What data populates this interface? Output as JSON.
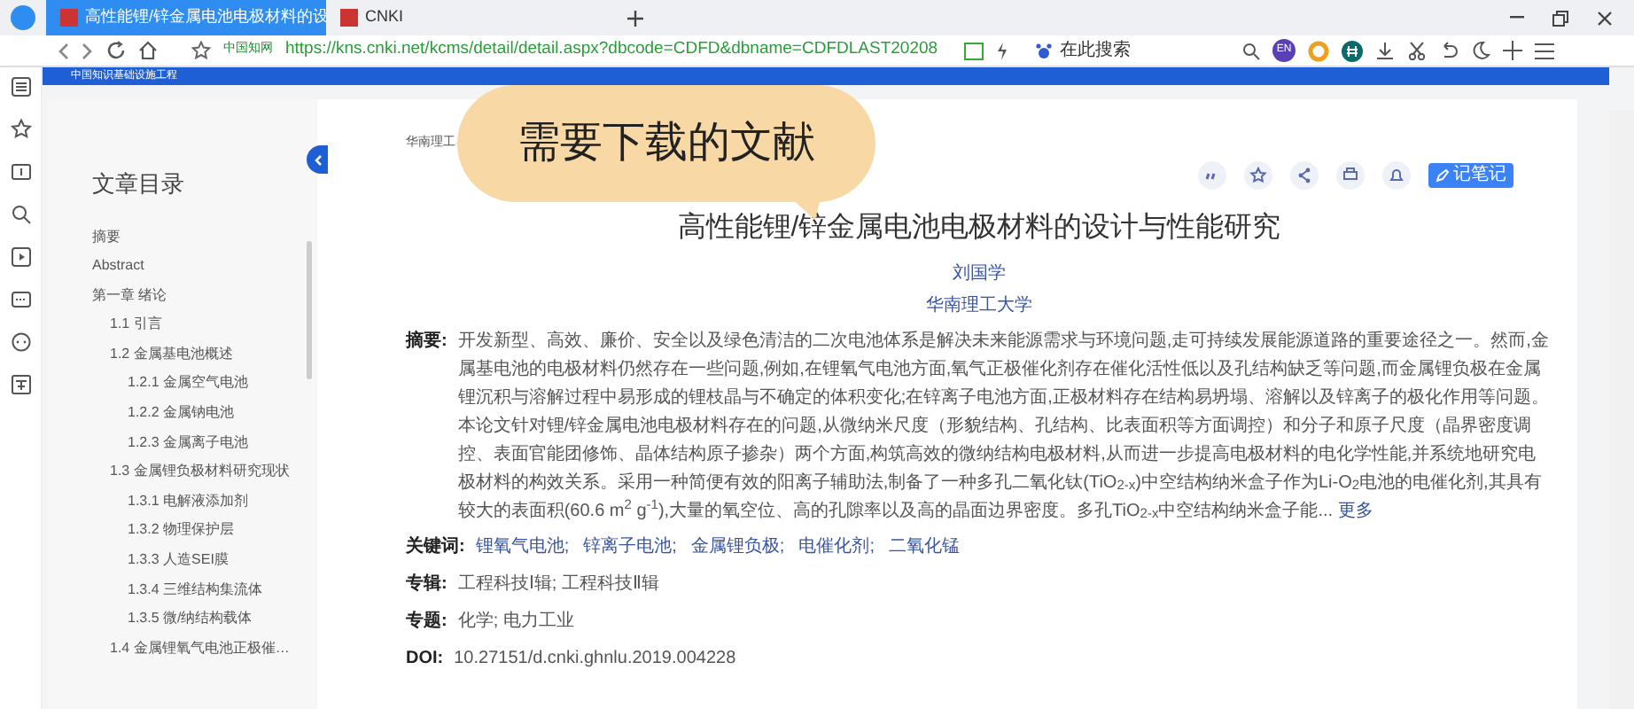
{
  "browser": {
    "tabs": [
      {
        "label": "高性能锂/锌金属电池电极材料的设",
        "selected": true
      },
      {
        "label": "CNKI",
        "selected": false
      }
    ],
    "address": {
      "site": "中国知网",
      "url": "https://kns.cnki.net/kcms/detail/detail.aspx?dbcode=CDFD&dbname=CDFDLAST20208"
    },
    "search": {
      "placeholder": "在此搜索"
    },
    "profile": "EN"
  },
  "banner": "中国知识基础设施工程",
  "toc": {
    "title": "文章目录",
    "items": [
      {
        "label": "摘要"
      },
      {
        "label": "Abstract"
      },
      {
        "label": "第一章 绪论",
        "children": [
          {
            "label": "1.1 引言"
          },
          {
            "label": "1.2 金属基电池概述",
            "children": [
              {
                "label": "1.2.1 金属空气电池"
              },
              {
                "label": "1.2.2 金属钠电池"
              },
              {
                "label": "1.2.3 金属离子电池"
              }
            ]
          },
          {
            "label": "1.3 金属锂负极材料研究现状",
            "children": [
              {
                "label": "1.3.1 电解液添加剂"
              },
              {
                "label": "1.3.2 物理保护层"
              },
              {
                "label": "1.3.3 人造SEI膜"
              },
              {
                "label": "1.3.4 三维结构集流体"
              },
              {
                "label": "1.3.5 微/纳结构载体"
              }
            ]
          },
          {
            "label": "1.4 金属锂氧气电池正极催…"
          }
        ]
      }
    ]
  },
  "callout": "需要下载的文献",
  "article": {
    "source": "华南理工",
    "note_button": "记笔记",
    "title": "高性能锂/锌金属电池电极材料的设计与性能研究",
    "author": "刘国学",
    "affiliation": "华南理工大学",
    "fields": [
      {
        "kind": "abstract",
        "label": "摘要:",
        "text": "开发新型、高效、廉价、安全以及绿色清洁的二次电池体系是解决未来能源需求与环境问题,走可持续发展能源道路的重要途径之一。然而,金属基电池的电极材料仍然存在一些问题,例如,在锂氧气电池方面,氧气正极催化剂存在催化活性低以及孔结构缺乏等问题,而金属锂负极在金属锂沉积与溶解过程中易形成的锂枝晶与不确定的体积变化;在锌离子电池方面,正极材料存在结构易坍塌、溶解以及锌离子的极化作用等问题。本论文针对锂/锌金属电池电极材料存在的问题,从微纳米尺度（形貌结构、孔结构、比表面积等方面调控）和分子和原子尺度（晶界密度调控、表面官能团修饰、晶体结构原子掺杂）两个方面,构筑高效的微纳结构电极材料,从而进一步提高电极材料的电化学性能,并系统地研究电极材料的构效关系。采用一种简便有效的阳离子辅助法,制备了一种多孔二氧化钛(TiO$_{2-x}$)中空结构纳米盒子作为Li-O$_{2}$电池的电催化剂,其具有较大的表面积(60.6 m$^{2}$ g$^{-1}$),大量的氧空位、高的孔隙率以及高的晶面边界密度。多孔TiO$_{2-x}$中空结构纳米盒子能...",
        "more": "更多"
      },
      {
        "kind": "links",
        "label": "关键词:",
        "values": [
          "锂氧气电池;",
          "锌离子电池;",
          "金属锂负极;",
          "电催化剂;",
          "二氧化锰"
        ]
      },
      {
        "kind": "plain",
        "label": "专辑:",
        "text": "工程科技Ⅰ辑; 工程科技Ⅱ辑"
      },
      {
        "kind": "plain",
        "label": "专题:",
        "text": "化学; 电力工业"
      },
      {
        "kind": "plain",
        "label": "DOI:",
        "text": "10.27151/d.cnki.ghnlu.2019.004228"
      }
    ]
  }
}
